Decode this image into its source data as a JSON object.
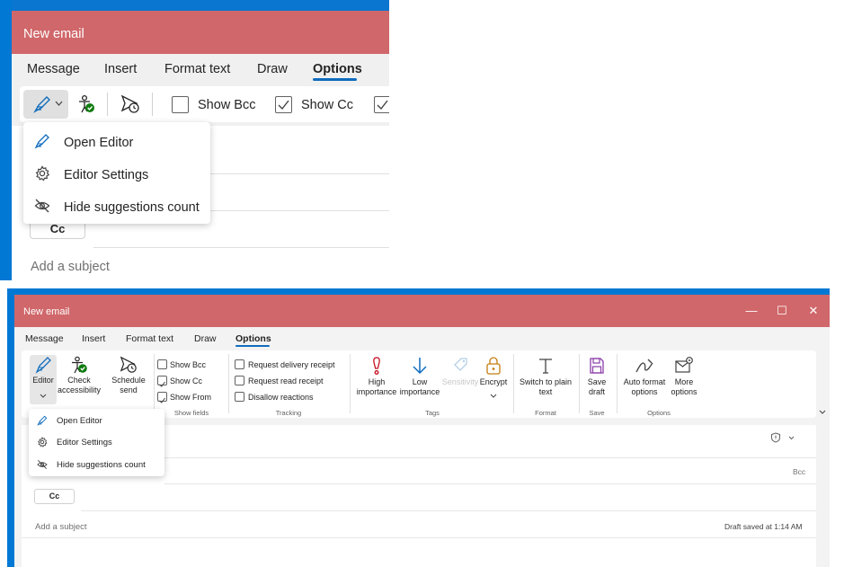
{
  "window": {
    "title": "New email",
    "controls": {
      "minimize": "—",
      "maximize": "☐",
      "close": "✕"
    }
  },
  "tabs": [
    {
      "label": "Message"
    },
    {
      "label": "Insert"
    },
    {
      "label": "Format text"
    },
    {
      "label": "Draw"
    },
    {
      "label": "Options",
      "active": true
    }
  ],
  "ribbon": {
    "editor": {
      "label": "Editor",
      "icon": "editor-pen-icon"
    },
    "check_accessibility": {
      "label_line1": "Check",
      "label_line2": "accessibility",
      "icon": "accessibility-check-icon"
    },
    "schedule_send": {
      "label_line1": "Schedule",
      "label_line2": "send",
      "icon": "schedule-send-icon"
    },
    "show_fields": {
      "group_label": "Show fields",
      "items": [
        {
          "label": "Show Bcc",
          "checked": false
        },
        {
          "label": "Show Cc",
          "checked": true
        },
        {
          "label": "Show From",
          "checked": true
        }
      ]
    },
    "tracking": {
      "group_label": "Tracking",
      "items": [
        {
          "label": "Request delivery receipt",
          "checked": false
        },
        {
          "label": "Request read receipt",
          "checked": false
        },
        {
          "label": "Disallow reactions",
          "checked": false
        }
      ]
    },
    "tags": {
      "group_label": "Tags",
      "high": {
        "label_line1": "High",
        "label_line2": "importance"
      },
      "low": {
        "label_line1": "Low",
        "label_line2": "importance"
      },
      "sensitivity": {
        "label": "Sensitivity"
      },
      "encrypt": {
        "label": "Encrypt"
      }
    },
    "format": {
      "group_label": "Format",
      "label_line1": "Switch to plain",
      "label_line2": "text"
    },
    "save": {
      "group_label": "Save",
      "label_line1": "Save",
      "label_line2": "draft"
    },
    "options": {
      "group_label": "Options",
      "auto_format": {
        "label_line1": "Auto format",
        "label_line2": "options"
      },
      "more": {
        "label_line1": "More",
        "label_line2": "options"
      }
    }
  },
  "editor_menu": [
    {
      "label": "Open Editor",
      "icon": "editor-pen-icon"
    },
    {
      "label": "Editor Settings",
      "icon": "gear-icon"
    },
    {
      "label": "Hide suggestions count",
      "icon": "eye-off-icon"
    }
  ],
  "compose": {
    "cc_label": "Cc",
    "bcc_label": "Bcc",
    "subject_placeholder": "Add a subject",
    "draft_status": "Draft saved at 1:14 AM"
  },
  "colors": {
    "title_bar": "#d0676a",
    "accent": "#0f6cbd",
    "desktop": "#0078d4",
    "accessibility_green": "#107c10",
    "importance_red": "#c50f1f",
    "encrypt_orange": "#c27c0e",
    "save_purple": "#8a3ca8"
  }
}
